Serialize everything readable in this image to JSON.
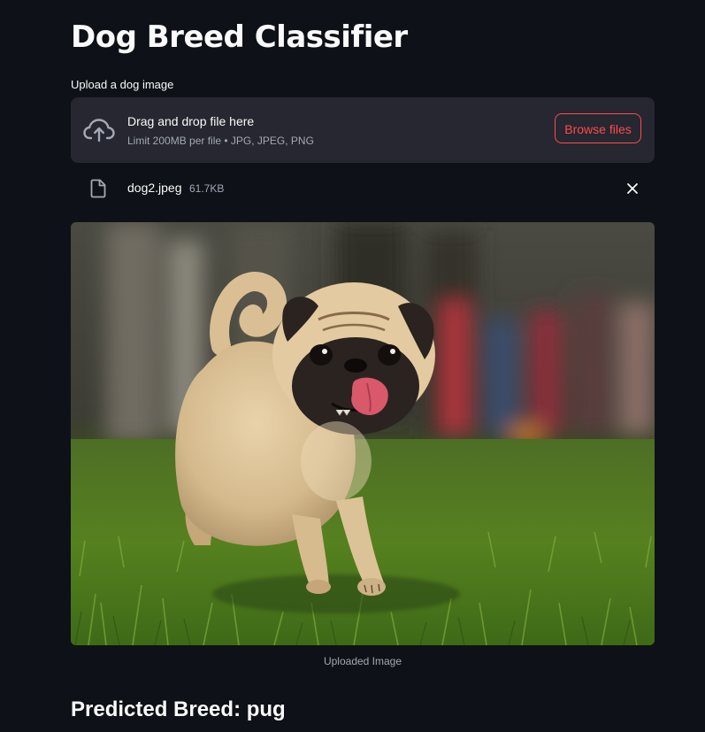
{
  "app": {
    "title": "Dog Breed Classifier"
  },
  "uploader": {
    "label": "Upload a dog image",
    "dropzone_text": "Drag and drop file here",
    "limit_text": "Limit 200MB per file • JPG, JPEG, PNG",
    "browse_label": "Browse files",
    "icon": "cloud-upload-icon",
    "file": {
      "name": "dog2.jpeg",
      "size": "61.7KB",
      "icon": "file-icon"
    }
  },
  "image": {
    "caption": "Uploaded Image"
  },
  "result": {
    "prediction": "Predicted Breed: pug"
  },
  "colors": {
    "background": "#0e1117",
    "panel": "#262730",
    "accent": "#ff4b4b",
    "text": "#fafafa",
    "muted": "#a3a8b4"
  }
}
